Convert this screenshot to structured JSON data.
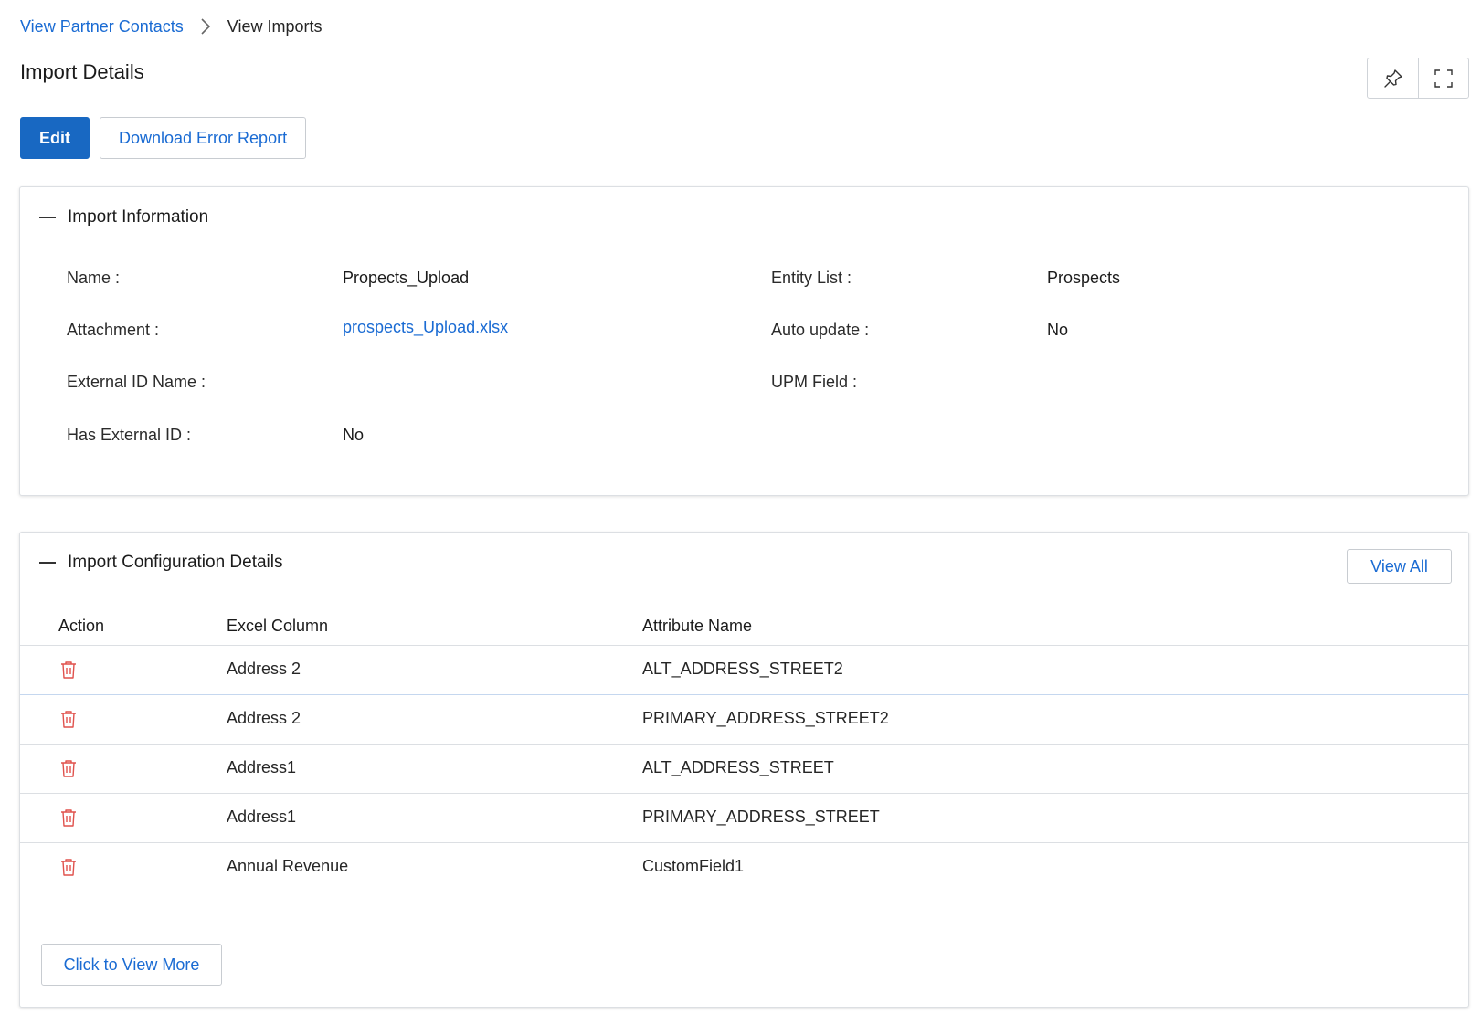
{
  "breadcrumb": {
    "parent": "View Partner Contacts",
    "current": "View Imports"
  },
  "page": {
    "title": "Import Details"
  },
  "toolbar": {
    "pin_icon": "pin-icon",
    "fullscreen_icon": "fullscreen-icon"
  },
  "actions": {
    "edit": "Edit",
    "download_error_report": "Download Error Report"
  },
  "import_info": {
    "title": "Import Information",
    "name_label": "Name :",
    "name_value": "Propects_Upload",
    "entity_list_label": "Entity List :",
    "entity_list_value": "Prospects",
    "attachment_label": "Attachment :",
    "attachment_value": "prospects_Upload.xlsx",
    "auto_update_label": "Auto update :",
    "auto_update_value": "No",
    "external_id_name_label": "External ID Name :",
    "upm_field_label": "UPM Field :",
    "has_external_id_label": "Has External ID :",
    "has_external_id_value": "No"
  },
  "config": {
    "title": "Import Configuration Details",
    "view_all": "View All",
    "columns": [
      "Action",
      "Excel Column",
      "Attribute Name"
    ],
    "rows": [
      {
        "excel_column": "Address 2",
        "attribute_name": "ALT_ADDRESS_STREET2"
      },
      {
        "excel_column": "Address 2",
        "attribute_name": "PRIMARY_ADDRESS_STREET2"
      },
      {
        "excel_column": "Address1",
        "attribute_name": "ALT_ADDRESS_STREET"
      },
      {
        "excel_column": "Address1",
        "attribute_name": "PRIMARY_ADDRESS_STREET"
      },
      {
        "excel_column": "Annual Revenue",
        "attribute_name": "CustomField1"
      }
    ],
    "view_more": "Click to View More"
  },
  "colors": {
    "accent": "#1a6bd3",
    "primary_button": "#1868c2",
    "delete_icon": "#e0514c"
  }
}
